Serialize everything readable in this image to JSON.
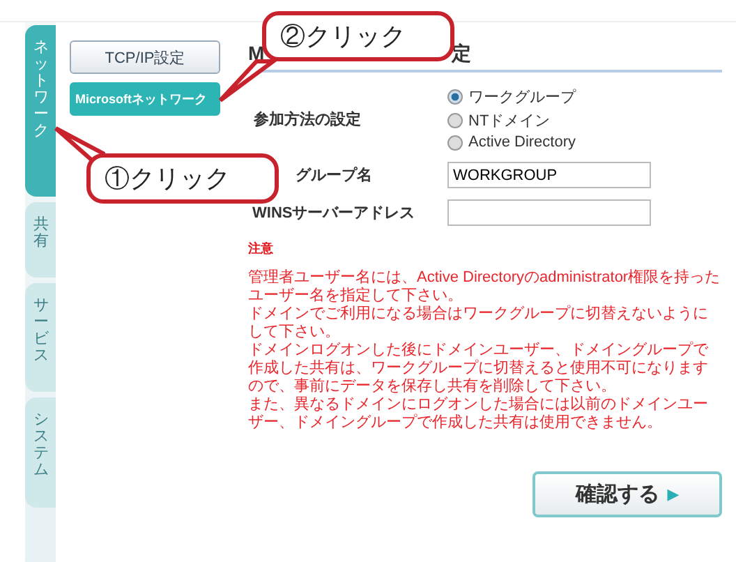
{
  "side_tabs": [
    {
      "label": "ネットワーク",
      "selected": true
    },
    {
      "label": "共有",
      "selected": false
    },
    {
      "label": "サービス",
      "selected": false
    },
    {
      "label": "システム",
      "selected": false
    }
  ],
  "sub_nav": [
    {
      "label": "TCP/IP設定",
      "selected": false
    },
    {
      "label": "Microsoftネットワーク",
      "selected": true
    }
  ],
  "heading": {
    "visible_start": "M",
    "visible_end": "定"
  },
  "join_method": {
    "label": "参加方法の設定",
    "options": [
      {
        "label": "ワークグループ",
        "selected": true
      },
      {
        "label": "NTドメイン",
        "selected": false
      },
      {
        "label": "Active Directory",
        "selected": false
      }
    ]
  },
  "fields": [
    {
      "label": "グループ名",
      "value": "WORKGROUP"
    },
    {
      "label": "WINSサーバーアドレス"
    }
  ],
  "notice": {
    "title": "注意",
    "lines": [
      "管理者ユーザー名には、Active Directoryのadministrator権限を持ったユーザー名を指定して下さい。",
      "ドメインでご利用になる場合はワークグループに切替えないようにして下さい。",
      "ドメインログオンした後にドメインユーザー、ドメイングループで作成した共有は、ワークグループに切替えると使用不可になりますので、事前にデータを保存し共有を削除して下さい。",
      "また、異なるドメインにログオンした場合には以前のドメインユーザー、ドメイングループで作成した共有は使用できません。"
    ]
  },
  "confirm_button": {
    "label": "確認する",
    "icon": "▸"
  },
  "callouts": [
    {
      "label": "②クリック"
    },
    {
      "label": "①クリック"
    }
  ]
}
